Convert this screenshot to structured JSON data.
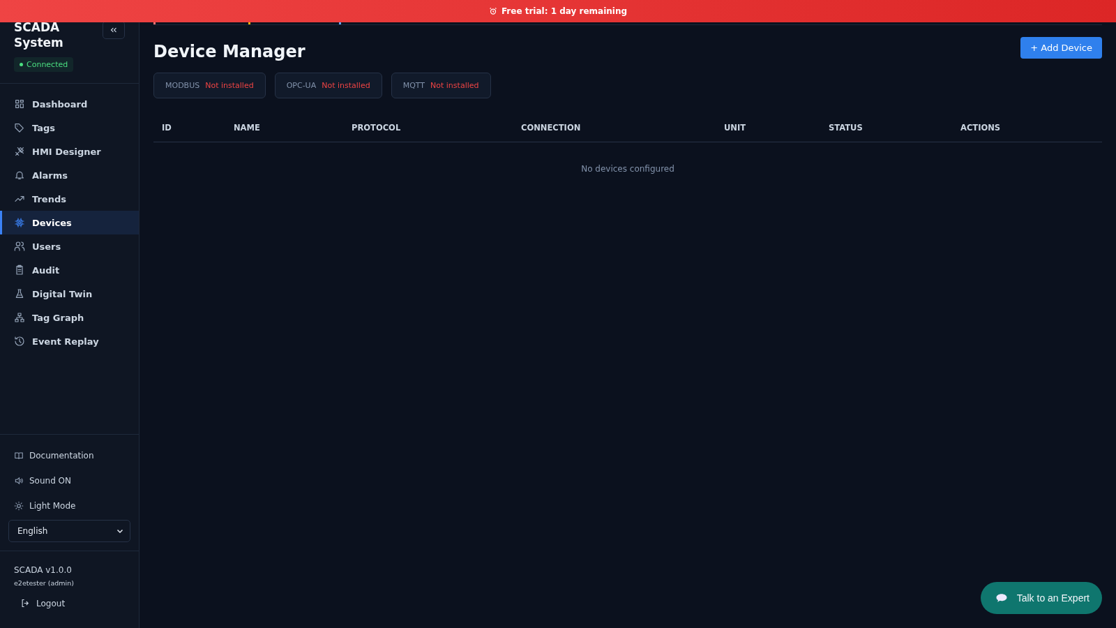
{
  "banner": {
    "text": "Free trial: 1 day remaining"
  },
  "sidebar": {
    "title": "SCADA System",
    "connection": "Connected",
    "items": [
      {
        "label": "Dashboard",
        "selected": false
      },
      {
        "label": "Tags",
        "selected": false
      },
      {
        "label": "HMI Designer",
        "selected": false
      },
      {
        "label": "Alarms",
        "selected": false
      },
      {
        "label": "Trends",
        "selected": false
      },
      {
        "label": "Devices",
        "selected": true
      },
      {
        "label": "Users",
        "selected": false
      },
      {
        "label": "Audit",
        "selected": false
      },
      {
        "label": "Digital Twin",
        "selected": false
      },
      {
        "label": "Tag Graph",
        "selected": false
      },
      {
        "label": "Event Replay",
        "selected": false
      }
    ],
    "links": [
      "Documentation",
      "Sound ON",
      "Light Mode"
    ],
    "language": "English",
    "version": "SCADA v1.0.0",
    "user": "e2etester (admin)",
    "logout": "Logout"
  },
  "page": {
    "title": "Device Manager",
    "add_button": "+ Add Device",
    "protocols": [
      {
        "name": "MODBUS",
        "status": "Not installed"
      },
      {
        "name": "OPC-UA",
        "status": "Not installed"
      },
      {
        "name": "MQTT",
        "status": "Not installed"
      }
    ],
    "table": {
      "columns": [
        "ID",
        "NAME",
        "PROTOCOL",
        "CONNECTION",
        "UNIT",
        "STATUS",
        "ACTIONS"
      ],
      "empty": "No devices configured"
    }
  },
  "chat_button": "Talk to an Expert"
}
